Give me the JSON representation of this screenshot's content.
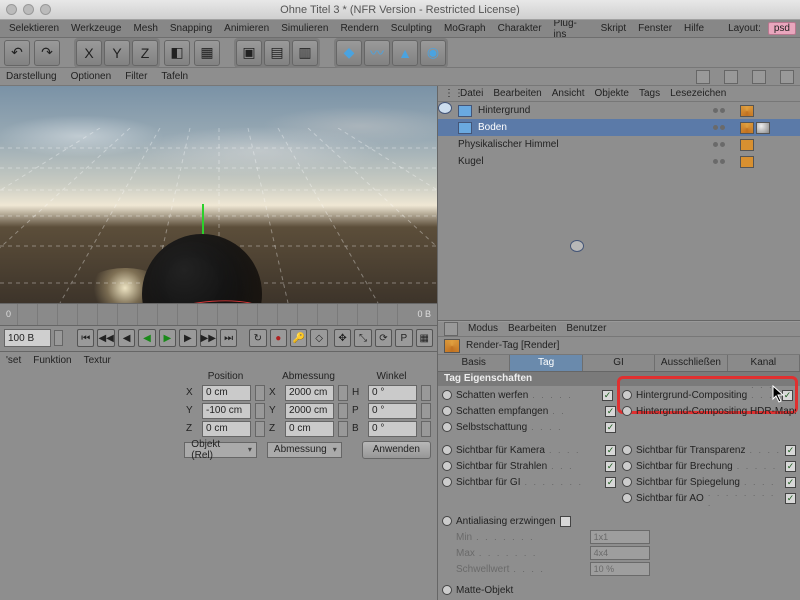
{
  "title": "Ohne Titel 3 * (NFR Version - Restricted License)",
  "menu": [
    "Selektieren",
    "Werkzeuge",
    "Mesh",
    "Snapping",
    "Animieren",
    "Simulieren",
    "Rendern",
    "Sculpting",
    "MoGraph",
    "Charakter",
    "Plug-ins",
    "Skript",
    "Fenster",
    "Hilfe"
  ],
  "layout_label": "Layout:",
  "layout_value": "psd",
  "subbar": {
    "items": [
      "Darstellung",
      "Optionen",
      "Filter",
      "Tafeln"
    ]
  },
  "timeline": {
    "start": "0",
    "end_label": "0 B",
    "current": "100 B"
  },
  "tabsrow": [
    "Funktion",
    "Textur"
  ],
  "tabsrow_first": "'set",
  "coord_headers": [
    "Position",
    "Abmessung",
    "Winkel"
  ],
  "coords": {
    "X": {
      "pos": "0 cm",
      "size": "2000 cm",
      "ang_label": "H",
      "ang": "0 °"
    },
    "Y": {
      "pos": "-100 cm",
      "size": "2000 cm",
      "ang_label": "P",
      "ang": "0 °"
    },
    "Z": {
      "pos": "0 cm",
      "size": "0 cm",
      "ang_label": "B",
      "ang": "0 °"
    }
  },
  "coord_mode": "Objekt (Rel)",
  "coord_size_mode": "Abmessung",
  "apply": "Anwenden",
  "obj_menu": [
    "Datei",
    "Bearbeiten",
    "Ansicht",
    "Objekte",
    "Tags",
    "Lesezeichen"
  ],
  "objects": [
    {
      "name": "Hintergrund",
      "sel": false,
      "tags": [
        "render"
      ]
    },
    {
      "name": "Boden",
      "sel": true,
      "tags": [
        "render",
        "mat"
      ]
    },
    {
      "name": "Physikalischer Himmel",
      "sel": false,
      "tags": [
        "comp"
      ]
    },
    {
      "name": "Kugel",
      "sel": false,
      "tags": [
        "comp"
      ]
    }
  ],
  "attr_menu": [
    "Modus",
    "Bearbeiten",
    "Benutzer"
  ],
  "attr_title": "Render-Tag [Render]",
  "attr_tabs": [
    "Basis",
    "Tag",
    "GI",
    "Ausschließen",
    "Kanal"
  ],
  "attr_tab_active": 1,
  "section_title": "Tag Eigenschaften",
  "props_left1": [
    {
      "label": "Schatten werfen",
      "checked": true
    },
    {
      "label": "Schatten empfangen",
      "checked": true
    },
    {
      "label": "Selbstschattung",
      "checked": true
    }
  ],
  "props_right1": [
    {
      "label": "Hintergrund-Compositing",
      "checked": true,
      "hl": true
    },
    {
      "label": "Hintergrund-Compositing HDR-Maps",
      "checked": false
    }
  ],
  "props_left2": [
    {
      "label": "Sichtbar für Kamera",
      "checked": true
    },
    {
      "label": "Sichtbar für Strahlen",
      "checked": true
    },
    {
      "label": "Sichtbar für GI",
      "checked": true
    }
  ],
  "props_right2": [
    {
      "label": "Sichtbar für Transparenz",
      "checked": true
    },
    {
      "label": "Sichtbar für Brechung",
      "checked": true
    },
    {
      "label": "Sichtbar für Spiegelung",
      "checked": true
    },
    {
      "label": "Sichtbar für AO",
      "checked": true
    }
  ],
  "props_extra": {
    "aa": {
      "label": "Antialiasing erzwingen",
      "checked": false
    },
    "min": {
      "label": "Min",
      "value": "1x1"
    },
    "max": {
      "label": "Max",
      "value": "4x4"
    },
    "thresh": {
      "label": "Schwellwert",
      "value": "10 %"
    },
    "matte": {
      "label": "Matte-Objekt"
    }
  }
}
